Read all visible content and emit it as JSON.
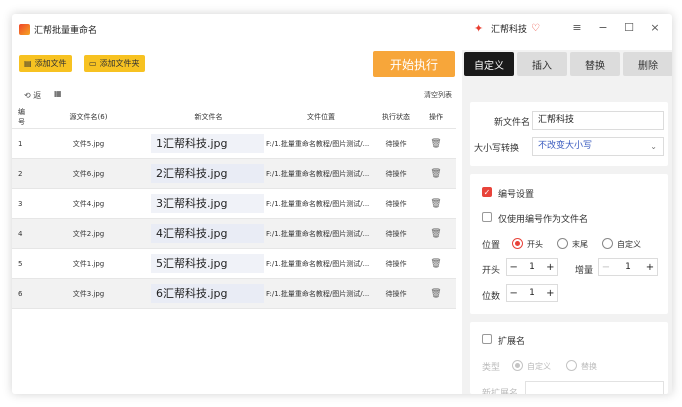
{
  "app": {
    "title": "汇帮批量重命名",
    "brand_name": "汇帮科技"
  },
  "window_controls": {
    "menu": "≡",
    "minimize": "−",
    "maximize": "☐",
    "close": "×"
  },
  "toolbar": {
    "add_file": "添加文件",
    "add_folder": "添加文件夹",
    "start": "开始执行"
  },
  "list_tools": {
    "undo": "⟲ 返",
    "grid": "▦",
    "clear": "清空列表"
  },
  "table": {
    "headers": {
      "num": "编号",
      "orig": "源文件名(6)",
      "new": "新文件名",
      "path": "文件位置",
      "status": "执行状态",
      "op": "操作"
    },
    "rows": [
      {
        "num": "1",
        "orig": "文件5.jpg",
        "new": "1汇帮科技.jpg",
        "path": "F:/1.批量重命名教程/图片测试/...",
        "status": "待操作"
      },
      {
        "num": "2",
        "orig": "文件6.jpg",
        "new": "2汇帮科技.jpg",
        "path": "F:/1.批量重命名教程/图片测试/...",
        "status": "待操作"
      },
      {
        "num": "3",
        "orig": "文件4.jpg",
        "new": "3汇帮科技.jpg",
        "path": "F:/1.批量重命名教程/图片测试/...",
        "status": "待操作"
      },
      {
        "num": "4",
        "orig": "文件2.jpg",
        "new": "4汇帮科技.jpg",
        "path": "F:/1.批量重命名教程/图片测试/...",
        "status": "待操作"
      },
      {
        "num": "5",
        "orig": "文件1.jpg",
        "new": "5汇帮科技.jpg",
        "path": "F:/1.批量重命名教程/图片测试/...",
        "status": "待操作"
      },
      {
        "num": "6",
        "orig": "文件3.jpg",
        "new": "6汇帮科技.jpg",
        "path": "F:/1.批量重命名教程/图片测试/...",
        "status": "待操作"
      }
    ]
  },
  "tabs": [
    "自定义",
    "插入",
    "替换",
    "删除"
  ],
  "custom": {
    "new_name_label": "新文件名",
    "new_name_value": "汇帮科技",
    "case_label": "大小写转换",
    "case_value": "不改变大小写",
    "numbering_label": "编号设置",
    "only_number_label": "仅使用编号作为文件名",
    "position_label": "位置",
    "pos_head": "开头",
    "pos_tail": "末尾",
    "pos_custom": "自定义",
    "start_label": "开头",
    "start_value": "1",
    "increment_label": "增量",
    "increment_value": "1",
    "digits_label": "位数",
    "digits_value": "1",
    "ext_label": "扩展名",
    "type_label": "类型",
    "type_custom": "自定义",
    "type_replace": "替换",
    "new_ext_label": "新扩展名",
    "new_ext_value": ""
  },
  "colors": {
    "accent_red": "#e8433a",
    "start_orange": "#f7a63a",
    "button_yellow": "#f7c221",
    "tab_active": "#1a1a1a"
  }
}
